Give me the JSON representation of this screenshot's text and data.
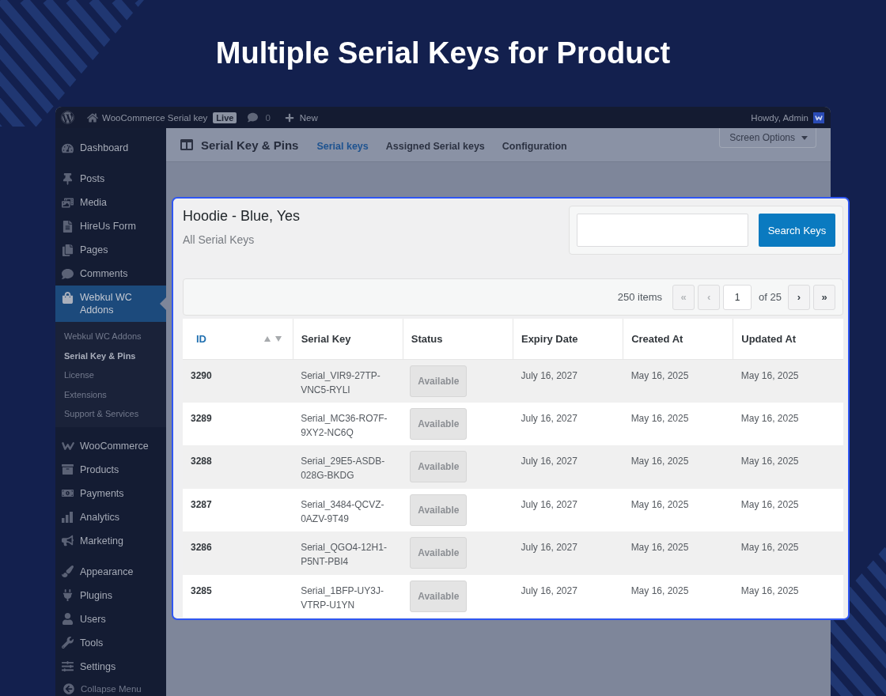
{
  "title": "Multiple Serial Keys for Product",
  "admin_bar": {
    "site_name": "WooCommerce Serial key",
    "badge": "Live",
    "comments_count": "0",
    "new_label": "New",
    "greeting": "Howdy, Admin"
  },
  "sidebar": {
    "groups": [
      {
        "items": [
          {
            "label": "Dashboard",
            "selected": false
          }
        ]
      },
      {
        "items": [
          {
            "label": "Posts",
            "selected": false
          },
          {
            "label": "Media",
            "selected": false
          },
          {
            "label": "HireUs Form",
            "selected": false
          },
          {
            "label": "Pages",
            "selected": false
          },
          {
            "label": "Comments",
            "selected": false
          },
          {
            "label": "Webkul WC Addons",
            "selected": true,
            "children": [
              {
                "label": "Webkul WC Addons",
                "selected": false
              },
              {
                "label": "Serial Key & Pins",
                "selected": true
              },
              {
                "label": "License",
                "selected": false
              },
              {
                "label": "Extensions",
                "selected": false
              },
              {
                "label": "Support & Services",
                "selected": false
              }
            ]
          }
        ]
      },
      {
        "items": [
          {
            "label": "WooCommerce",
            "selected": false
          },
          {
            "label": "Products",
            "selected": false
          },
          {
            "label": "Payments",
            "selected": false
          },
          {
            "label": "Analytics",
            "selected": false
          },
          {
            "label": "Marketing",
            "selected": false
          }
        ]
      },
      {
        "items": [
          {
            "label": "Appearance",
            "selected": false
          },
          {
            "label": "Plugins",
            "selected": false
          },
          {
            "label": "Users",
            "selected": false
          },
          {
            "label": "Tools",
            "selected": false
          },
          {
            "label": "Settings",
            "selected": false
          }
        ]
      }
    ],
    "collapse_label": "Collapse Menu"
  },
  "page_header": {
    "title": "Serial Key & Pins",
    "tabs": [
      {
        "label": "Serial keys",
        "selected": true
      },
      {
        "label": "Assigned Serial keys",
        "selected": false
      },
      {
        "label": "Configuration",
        "selected": false
      }
    ],
    "screen_options": "Screen Options"
  },
  "card": {
    "title": "Hoodie - Blue, Yes",
    "subtitle": "All Serial Keys",
    "search_button": "Search Keys",
    "pagination": {
      "count": "250 items",
      "back": [
        {
          "label": "«",
          "disabled": true
        },
        {
          "label": "‹",
          "disabled": true
        }
      ],
      "page": "1",
      "total": "of 25",
      "forward": [
        {
          "label": "›",
          "disabled": false
        },
        {
          "label": "»",
          "disabled": false
        }
      ]
    },
    "table": {
      "columns": [
        {
          "label": "ID",
          "sortable": true
        },
        {
          "label": "Serial Key",
          "sortable": false
        },
        {
          "label": "Status",
          "sortable": false
        },
        {
          "label": "Expiry Date",
          "sortable": false
        },
        {
          "label": "Created At",
          "sortable": false
        },
        {
          "label": "Updated At",
          "sortable": false
        }
      ],
      "rows": [
        {
          "id": "3290",
          "serial_key": "Serial_VIR9-27TP-VNC5-RYLI",
          "status": "Available",
          "expiry_date": "July 16, 2027",
          "created_at": "May 16, 2025",
          "updated_at": "May 16, 2025"
        },
        {
          "id": "3289",
          "serial_key": "Serial_MC36-RO7F-9XY2-NC6Q",
          "status": "Available",
          "expiry_date": "July 16, 2027",
          "created_at": "May 16, 2025",
          "updated_at": "May 16, 2025"
        },
        {
          "id": "3288",
          "serial_key": "Serial_29E5-ASDB-028G-BKDG",
          "status": "Available",
          "expiry_date": "July 16, 2027",
          "created_at": "May 16, 2025",
          "updated_at": "May 16, 2025"
        },
        {
          "id": "3287",
          "serial_key": "Serial_3484-QCVZ-0AZV-9T49",
          "status": "Available",
          "expiry_date": "July 16, 2027",
          "created_at": "May 16, 2025",
          "updated_at": "May 16, 2025"
        },
        {
          "id": "3286",
          "serial_key": "Serial_QGO4-12H1-P5NT-PBI4",
          "status": "Available",
          "expiry_date": "July 16, 2027",
          "created_at": "May 16, 2025",
          "updated_at": "May 16, 2025"
        },
        {
          "id": "3285",
          "serial_key": "Serial_1BFP-UY3J-VTRP-U1YN",
          "status": "Available",
          "expiry_date": "July 16, 2027",
          "created_at": "May 16, 2025",
          "updated_at": "May 16, 2025"
        }
      ]
    }
  }
}
